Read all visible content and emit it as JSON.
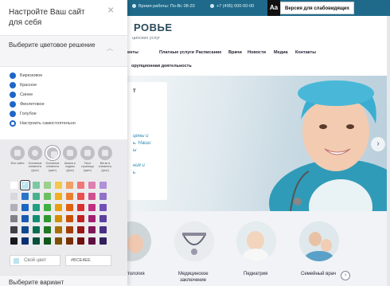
{
  "site": {
    "topbar": {
      "hours": "Время работы: Пн-Вс 08-20",
      "phone": "+7 (495) 000-00-00",
      "aa_label": "Aa",
      "low_vision_label": "Версия для слабовидящих"
    },
    "brand_title": "РОВЬЕ",
    "brand_subtitle": "цинских услуг",
    "nav": [
      "енты",
      "Платные услуги",
      "Расписание",
      "Врачи",
      "Новости",
      "Медиа",
      "Контакты"
    ],
    "nav_second_row": "орупционная деятельность",
    "hero": {
      "card_letter": "Т",
      "text_lines": [
        "цены и",
        "ь. Наши",
        "ы",
        "ния и",
        "ь"
      ]
    },
    "services": [
      {
        "label_lines": [
          "тология"
        ]
      },
      {
        "label_lines": [
          "Медицинское",
          "заключение"
        ]
      },
      {
        "label_lines": [
          "Педиатрия"
        ]
      },
      {
        "label_lines": [
          "Семейный врач"
        ]
      }
    ]
  },
  "panel": {
    "title": "Настройте Ваш сайт для себя",
    "section_color": {
      "title": "Выберите цветовое решение",
      "options": [
        {
          "label": "Бирюзовое",
          "selected": true
        },
        {
          "label": "Красное",
          "selected": true
        },
        {
          "label": "Синее",
          "selected": true
        },
        {
          "label": "Фиолетовое",
          "selected": true
        },
        {
          "label": "Голубое",
          "selected": true
        },
        {
          "label": "Настроить самостоятельно",
          "selected": false
        }
      ]
    },
    "color_tabs": [
      {
        "label": "Фон сайта",
        "icon": "square-icon"
      },
      {
        "label": "Основные элементы (фон)",
        "icon": "star-icon"
      },
      {
        "label": "Основные элементы (цвет)",
        "icon": "grid-icon"
      },
      {
        "label": "Шапка и подвал (фон)",
        "icon": "layout-icon"
      },
      {
        "label": "Текст страницы (цвет)",
        "icon": "text-icon"
      },
      {
        "label": "Ветки в элементы (фон)",
        "icon": "branch-icon"
      }
    ],
    "palette": [
      [
        "#ffffff",
        "#3a8fd0",
        "#7ac9a4",
        "#9ad08a",
        "#f5c84a",
        "#f0a060",
        "#f07878",
        "#e080b0",
        "#b090d8"
      ],
      [
        "#d8d8dc",
        "#2a74c8",
        "#4ab090",
        "#6cc060",
        "#f0b020",
        "#e88030",
        "#e85050",
        "#d05090",
        "#9070c8"
      ],
      [
        "#b0b0b8",
        "#1a66c0",
        "#20a080",
        "#40b040",
        "#e8a010",
        "#e06010",
        "#d83030",
        "#c03080",
        "#7050b8"
      ],
      [
        "#808088",
        "#1a5ab0",
        "#109070",
        "#309830",
        "#d09000",
        "#c85000",
        "#c02020",
        "#a02070",
        "#5a40a0"
      ],
      [
        "#404048",
        "#104890",
        "#087050",
        "#207820",
        "#a87000",
        "#a04000",
        "#981818",
        "#801858",
        "#483088"
      ],
      [
        "#18181c",
        "#083070",
        "#045038",
        "#105818",
        "#805000",
        "#783000",
        "#701010",
        "#601040",
        "#302060"
      ]
    ],
    "selected_swatch": "#bce3ee",
    "own_color_label": "Свой цвет",
    "hex_value": "#BCE4EE",
    "section_variant": {
      "title": "Выберите вариант"
    }
  }
}
